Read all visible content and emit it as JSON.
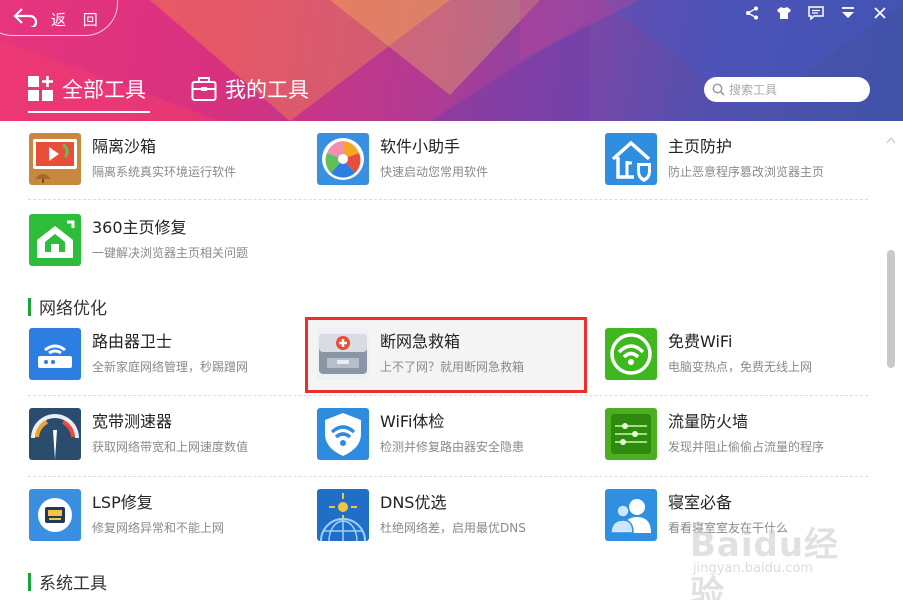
{
  "header": {
    "back_label": "返 回",
    "tabs": [
      {
        "label": "全部工具"
      },
      {
        "label": "我的工具"
      }
    ],
    "search_placeholder": "搜索工具"
  },
  "sections": [
    {
      "title": "网络优化"
    },
    {
      "title": "系统工具"
    }
  ],
  "tools": [
    {
      "title": "隔离沙箱",
      "desc": "隔离系统真实环境运行软件",
      "icon": "sandbox-icon",
      "color": "#c9883f"
    },
    {
      "title": "软件小助手",
      "desc": "快速启动您常用软件",
      "icon": "software-helper-icon",
      "color": "#3b8fe0"
    },
    {
      "title": "主页防护",
      "desc": "防止恶意程序篡改浏览器主页",
      "icon": "homepage-protect-icon",
      "color": "#2f8ee0"
    },
    {
      "title": "360主页修复",
      "desc": "一键解决浏览器主页相关问题",
      "icon": "homepage-repair-icon",
      "color": "#2ebd3b"
    },
    {
      "title": "路由器卫士",
      "desc": "全新家庭网络管理，秒踢蹭网",
      "icon": "router-icon",
      "color": "#2c7fe0"
    },
    {
      "title": "断网急救箱",
      "desc": "上不了网？就用断网急救箱",
      "icon": "first-aid-kit-icon",
      "color": "#8a95a5"
    },
    {
      "title": "免费WiFi",
      "desc": "电脑变热点，免费无线上网",
      "icon": "wifi-icon",
      "color": "#3fb820"
    },
    {
      "title": "宽带测速器",
      "desc": "获取网络带宽和上网速度数值",
      "icon": "speedometer-icon",
      "color": "#2a4d6e"
    },
    {
      "title": "WiFi体检",
      "desc": "检测并修复路由器安全隐患",
      "icon": "wifi-shield-icon",
      "color": "#2d8be0"
    },
    {
      "title": "流量防火墙",
      "desc": "发现并阻止偷偷占流量的程序",
      "icon": "traffic-firewall-icon",
      "color": "#4caf1f"
    },
    {
      "title": "LSP修复",
      "desc": "修复网络异常和不能上网",
      "icon": "lsp-repair-icon",
      "color": "#3b8fe0"
    },
    {
      "title": "DNS优选",
      "desc": "杜绝网络差，启用最优DNS",
      "icon": "dns-globe-icon",
      "color": "#1f6fc8"
    },
    {
      "title": "寝室必备",
      "desc": "看看寝室室友在干什么",
      "icon": "dorm-users-icon",
      "color": "#2f8fe0"
    }
  ],
  "watermark": {
    "main": "Baidu经验",
    "sub": "jingyan.baidu.com"
  }
}
